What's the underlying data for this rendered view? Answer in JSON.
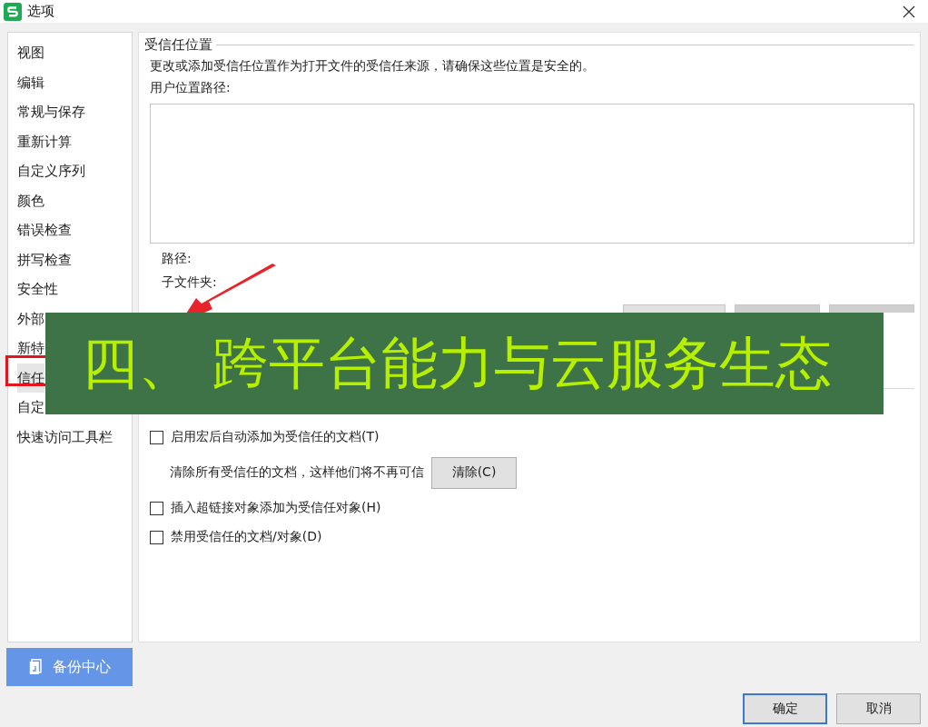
{
  "window": {
    "title": "选项"
  },
  "sidebar": {
    "items": [
      {
        "label": "视图",
        "selected": false
      },
      {
        "label": "编辑",
        "selected": false
      },
      {
        "label": "常规与保存",
        "selected": false
      },
      {
        "label": "重新计算",
        "selected": false
      },
      {
        "label": "自定义序列",
        "selected": false
      },
      {
        "label": "颜色",
        "selected": false
      },
      {
        "label": "错误检查",
        "selected": false
      },
      {
        "label": "拼写检查",
        "selected": false
      },
      {
        "label": "安全性",
        "selected": false
      },
      {
        "label": "外部",
        "selected": false
      },
      {
        "label": "新特",
        "selected": false
      },
      {
        "label": "信任",
        "selected": true
      },
      {
        "label": "自定",
        "selected": false
      },
      {
        "label": "快速访问工具栏",
        "selected": false
      }
    ]
  },
  "content": {
    "group_title": "受信任位置",
    "description": "更改或添加受信任位置作为打开文件的受信任来源，请确保这些位置是安全的。",
    "list_label": "用户位置路径:",
    "path_label": "路径:",
    "subfolder_label": "子文件夹:"
  },
  "options": [
    {
      "kind": "checkbox",
      "label": "启用宏后自动添加为受信任的文档(T)",
      "checked": false
    },
    {
      "kind": "action",
      "label": "清除所有受信任的文档，这样他们将不再可信",
      "button": "清除(C)"
    },
    {
      "kind": "checkbox",
      "label": "插入超链接对象添加为受信任对象(H)",
      "checked": false
    },
    {
      "kind": "checkbox",
      "label": "禁用受信任的文档/对象(D)",
      "checked": false
    }
  ],
  "backup_button": "备份中心",
  "buttons": [
    {
      "label": "确定",
      "default": true
    },
    {
      "label": "取消",
      "default": false
    }
  ],
  "banner": {
    "text": "四、 跨平台能力与云服务生态"
  }
}
